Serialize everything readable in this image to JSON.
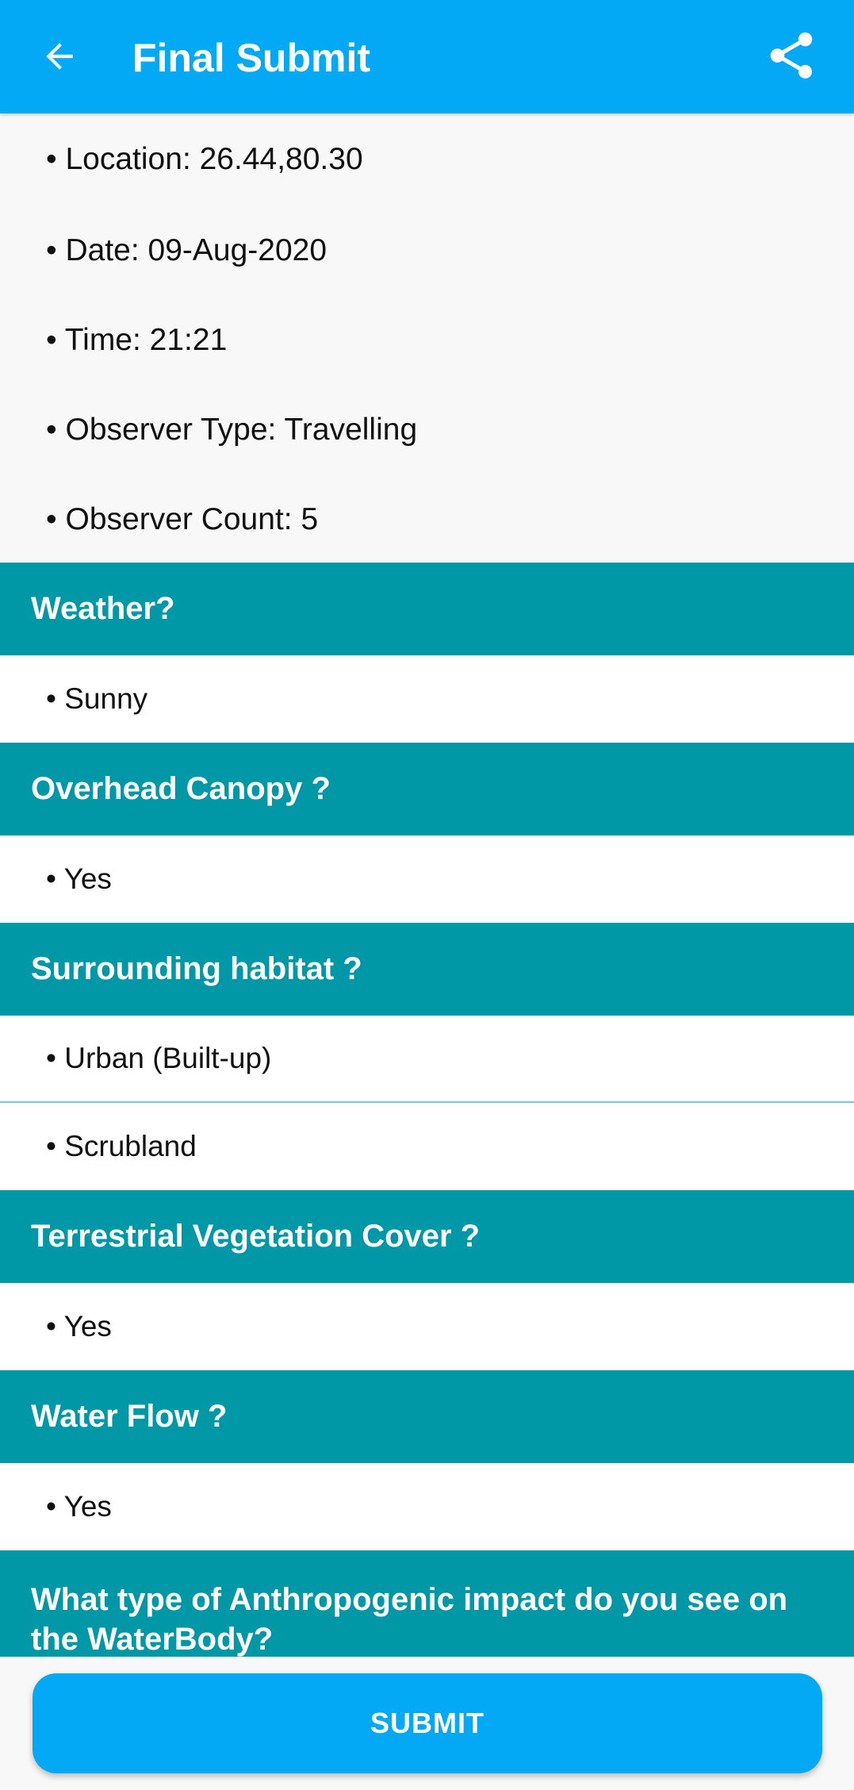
{
  "app_bar": {
    "title": "Final Submit",
    "back_icon": "arrow-back-icon",
    "share_icon": "share-icon",
    "color": "#03a9f4"
  },
  "summary": {
    "location": "• Location: 26.44,80.30",
    "date": "• Date: 09-Aug-2020",
    "time": "• Time: 21:21",
    "observer_type": "• Observer Type: Travelling",
    "observer_count": "• Observer Count: 5"
  },
  "sections": [
    {
      "question": "Weather?",
      "answers": [
        "• Sunny"
      ]
    },
    {
      "question": "Overhead Canopy ?",
      "answers": [
        "• Yes"
      ]
    },
    {
      "question": "Surrounding habitat ?",
      "answers": [
        "• Urban (Built-up)",
        "• Scrubland"
      ]
    },
    {
      "question": "Terrestrial Vegetation Cover ?",
      "answers": [
        "• Yes"
      ]
    },
    {
      "question": "Water Flow ?",
      "answers": [
        "• Yes"
      ]
    },
    {
      "question": "What type of Anthropogenic impact do you see on the WaterBody?",
      "answers": []
    }
  ],
  "section_header_color": "#0097a7",
  "footer": {
    "submit_label": "SUBMIT"
  }
}
